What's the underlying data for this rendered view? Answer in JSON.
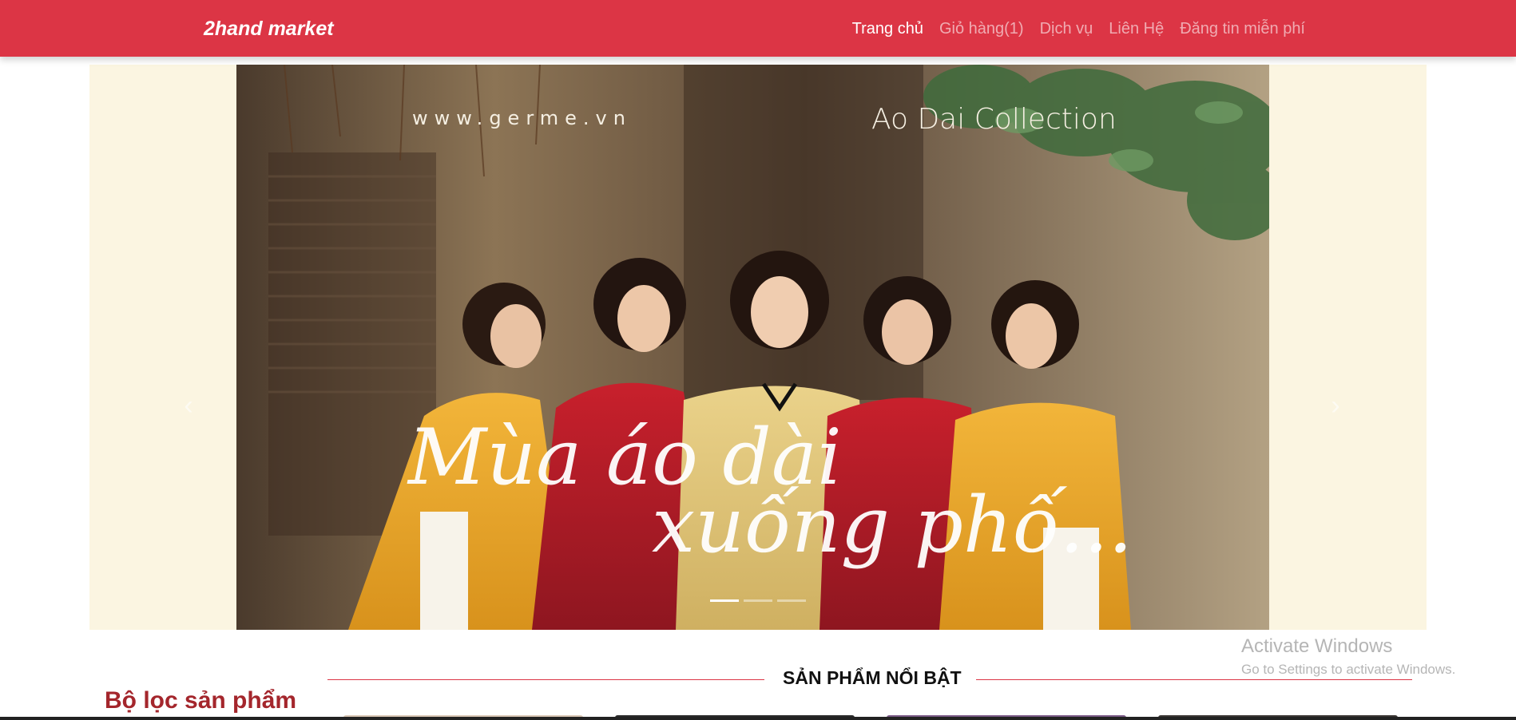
{
  "navbar": {
    "brand": "2hand market",
    "links": [
      {
        "label": "Trang chủ",
        "active": true
      },
      {
        "label": "Giỏ hàng(1)",
        "active": false
      },
      {
        "label": "Dịch vụ",
        "active": false
      },
      {
        "label": "Liên Hệ",
        "active": false
      },
      {
        "label": "Đăng tin miễn phí",
        "active": false
      }
    ],
    "color": "#dc3545"
  },
  "carousel": {
    "slide": {
      "watermark_url": "www.germe.vn",
      "collection_label": "Ao Dai Collection",
      "script_line_1": "Mùa áo dài",
      "script_line_2": "xuống phố..."
    },
    "prev_icon": "chevron-left-icon",
    "next_icon": "chevron-right-icon",
    "indicator_count": 3,
    "active_indicator": 0,
    "background": "#fbf5e1"
  },
  "featured": {
    "title": "SẢN PHẨM NỔI BẬT"
  },
  "filter": {
    "title": "Bộ lọc sản phẩm"
  },
  "windows_watermark": {
    "title": "Activate Windows",
    "subtitle": "Go to Settings to activate Windows."
  }
}
